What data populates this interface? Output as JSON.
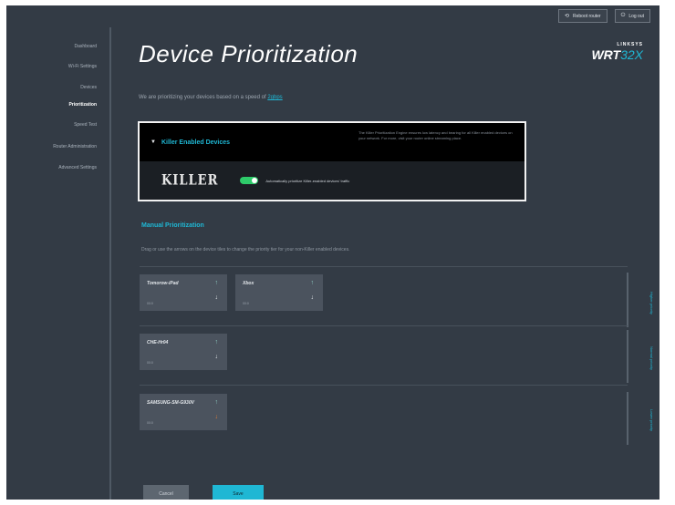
{
  "topbar": {
    "reboot_label": "Reboot router",
    "logout_label": "Log out"
  },
  "sidebar": {
    "items": [
      {
        "label": "Dashboard"
      },
      {
        "label": "Wi-Fi Settings"
      },
      {
        "label": "Devices"
      },
      {
        "label": "Prioritization"
      },
      {
        "label": "Speed Test"
      },
      {
        "label": "Router Administration"
      },
      {
        "label": "Advanced Settings"
      }
    ]
  },
  "header": {
    "title": "Device Prioritization",
    "brand_top": "LINKSYS",
    "brand_main": "WRT",
    "brand_model": "32X"
  },
  "subtitle": {
    "text": "We are prioritizing your devices based on a speed of",
    "link": "2gbps"
  },
  "killer": {
    "section_label": "Killer Enabled Devices",
    "description": "The Killer Prioritization Engine ensures low latency and bearing for all Killer enabled devices on your network. For more, visit your router online streaming place.",
    "logo_text": "KILLER",
    "toggle_label": "Automatically prioritize Killer-enabled devices' traffic"
  },
  "manual": {
    "title": "Manual Prioritization",
    "description": "Drag or use the arrows on the device tiles to change the priority tier for your non-Killer enabled devices."
  },
  "rows": [
    {
      "label": "Higher priority"
    },
    {
      "label": "Normal priority"
    },
    {
      "label": "Lower priority"
    }
  ],
  "devices": [
    {
      "name": "Tomorow-iPad",
      "mac": "00:0"
    },
    {
      "name": "Xbox",
      "mac": "00:0"
    },
    {
      "name": "CHE-Hr04",
      "mac": "00:0"
    },
    {
      "name": "SAMSUNG-SM-G930V",
      "mac": "00:0"
    }
  ],
  "actions": {
    "cancel_label": "Cancel",
    "save_label": "Save"
  },
  "colors": {
    "accent": "#1fb7d4",
    "background": "#333b45",
    "toggle_on": "#2ecb6a"
  }
}
